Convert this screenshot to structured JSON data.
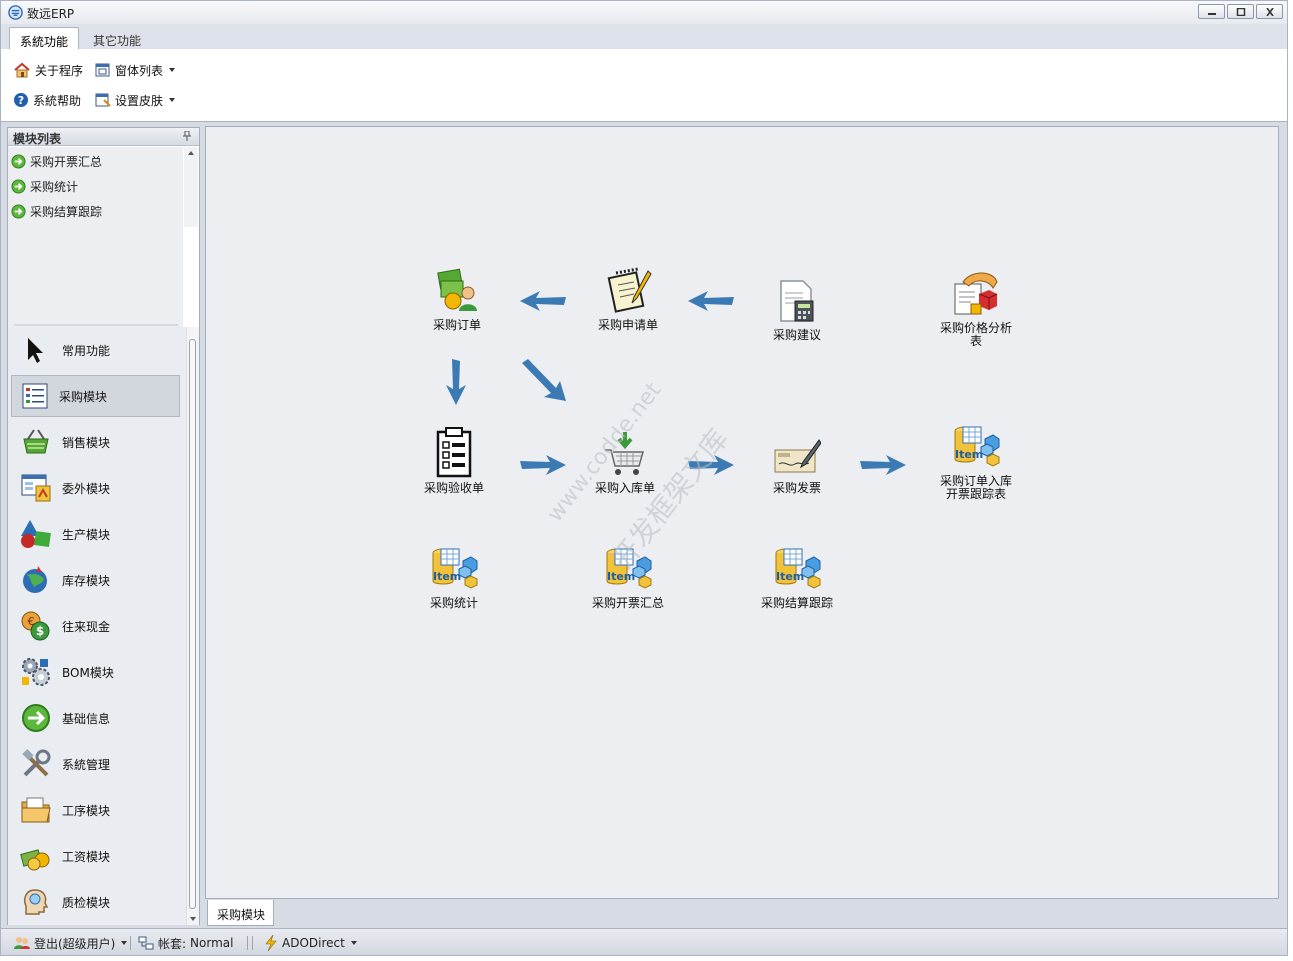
{
  "window": {
    "title": "致远ERP"
  },
  "tabs": [
    {
      "label": "系統功能",
      "active": true
    },
    {
      "label": "其它功能",
      "active": false
    }
  ],
  "ribbon": {
    "about": "关于程序",
    "window_list": "窗体列表",
    "help": "系統帮助",
    "skin": "设置皮肤"
  },
  "panel": {
    "title": "模块列表",
    "module_items": [
      "采购开票汇总",
      "采购统计",
      "采购结算跟踪"
    ],
    "nav_items": [
      {
        "label": "常用功能",
        "icon": "cursor-icon"
      },
      {
        "label": "采购模块",
        "icon": "list-icon",
        "selected": true
      },
      {
        "label": "销售模块",
        "icon": "basket-icon"
      },
      {
        "label": "委外模块",
        "icon": "window-chart-icon"
      },
      {
        "label": "生产模块",
        "icon": "shapes-icon"
      },
      {
        "label": "库存模块",
        "icon": "globe-icon"
      },
      {
        "label": "往来现金",
        "icon": "currency-icon"
      },
      {
        "label": "BOM模块",
        "icon": "gears-icon"
      },
      {
        "label": "基础信息",
        "icon": "green-arrow-icon"
      },
      {
        "label": "系統管理",
        "icon": "tools-icon"
      },
      {
        "label": "工序模块",
        "icon": "folder-icon"
      },
      {
        "label": "工资模块",
        "icon": "money-icon"
      },
      {
        "label": "质检模块",
        "icon": "head-icon"
      }
    ]
  },
  "flow": {
    "nodes": {
      "order": "采购订单",
      "request": "采购申请单",
      "suggest": "采购建议",
      "price": "采购价格分析\n表",
      "inspect": "采购验收单",
      "stockin": "采购入库单",
      "invoice": "采购发票",
      "track": "采购订单入库\n开票跟踪表",
      "stats": "采购统计",
      "invsum": "采购开票汇总",
      "settle": "采购结算跟踪"
    },
    "item_badge": "Item"
  },
  "doc_tab": "采购模块",
  "watermark": {
    "line1": "www.codde.net",
    "line2": "开发框架文库"
  },
  "status": {
    "user": "登出(超级用户)",
    "account_label": "帐套:",
    "account_value": "Normal",
    "db": "ADODirect"
  },
  "colors": {
    "arrow": "#3b7ab3",
    "accent": "#2d6db5"
  }
}
